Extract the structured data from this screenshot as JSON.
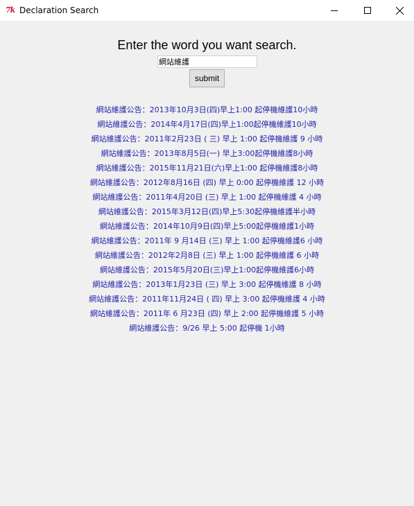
{
  "window": {
    "title": "Declaration Search",
    "icon": "tk-feather-icon",
    "controls": [
      "minimize-icon",
      "maximize-icon",
      "close-icon"
    ]
  },
  "search": {
    "prompt": "Enter the word you want search.",
    "value": "網站維護",
    "submit_label": "submit"
  },
  "results": [
    "網站維護公告：2013年10月3日(四)早上1:00 起停機維護10小時",
    "網站維護公告：2014年4月17日(四)早上1:00起停機維護10小時",
    "網站維護公告：2011年2月23日 ( 三) 早上 1:00 起停機維護 9 小時",
    "網站維護公告：2013年8月5日(一) 早上3:00起停機維護8小時",
    "網站維護公告：2015年11月21日(六)早上1:00 起停機維護8小時",
    "網站維護公告：2012年8月16日 (四) 早上 0:00 起停機維護 12 小時",
    "網站維護公告：2011年4月20日 (三) 早上 1:00 起停機維護 4 小時",
    "網站維護公告：2015年3月12日(四)早上5:30起停機維護半小時",
    "網站維護公告：2014年10月9日(四)早上5:00起停機維護1小時",
    "網站維護公告：2011年 9 月14日 (三) 早上 1:00 起停機維護6 小時",
    "網站維護公告：2012年2月8日 (三) 早上 1:00 起停機維護 6 小時",
    "網站維護公告：2015年5月20日(三)早上1:00起停機維護6小時",
    "網站維護公告：2013年1月23日 (三) 早上 3:00 起停機維護 8 小時",
    "網站維護公告：2011年11月24日 ( 四) 早上 3:00 起停機維護 4 小時",
    "網站維護公告：2011年 6 月23日 (四) 早上 2:00 起停機維護 5 小時",
    "網站維護公告：9/26 早上 5:00 起停機 1小時"
  ],
  "colors": {
    "result_text": "#2222aa",
    "background": "#f0f0f0",
    "titlebar": "#ffffff"
  }
}
